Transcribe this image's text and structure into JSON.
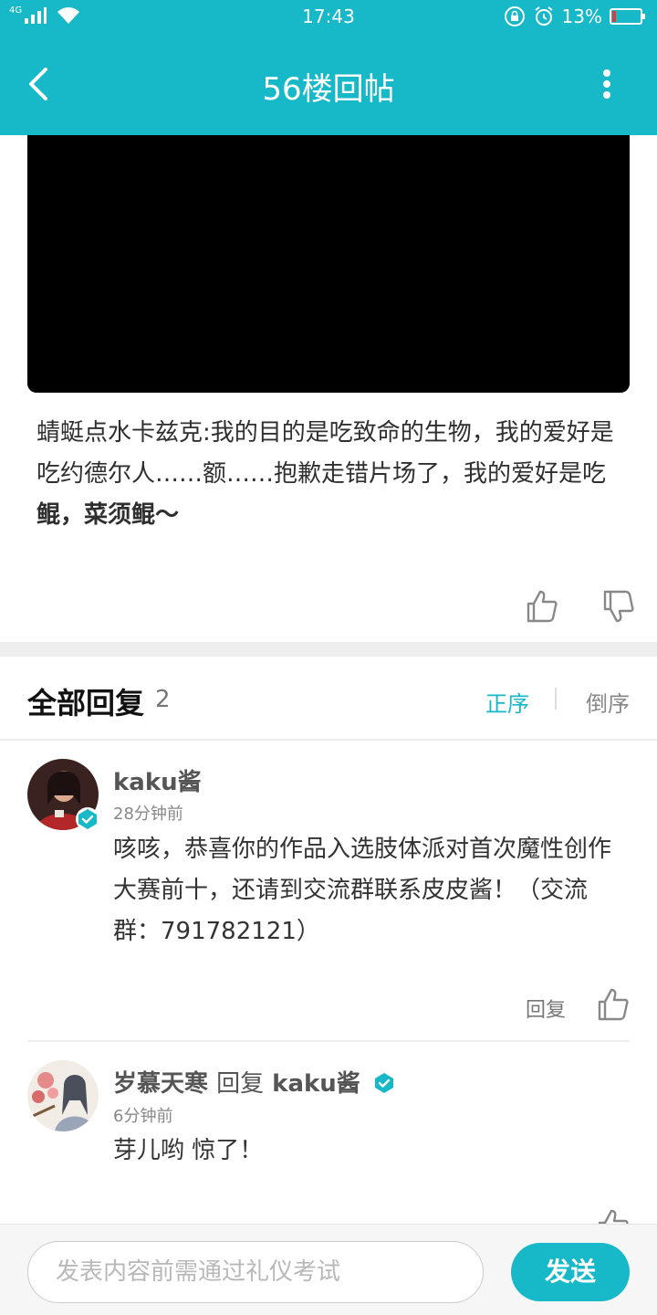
{
  "status_bar": {
    "network": "4G",
    "time": "17:43",
    "battery": "13%",
    "battery_level": 0.13
  },
  "header": {
    "title": "56楼回帖"
  },
  "post": {
    "text_plain": "蜻蜓点水卡兹克:我的目的是吃致命的生物，我的爱好是吃约德尔人……额……抱歉走错片场了，我的爱好是吃",
    "text_bold": "鲲，菜须鲲～"
  },
  "replies": {
    "title": "全部回复",
    "count": "2",
    "sort_asc": "正序",
    "sort_desc": "倒序",
    "items": [
      {
        "user": "kaku酱",
        "time": "28分钟前",
        "content": "咳咳，恭喜你的作品入选肢体派对首次魔性创作大赛前十，还请到交流群联系皮皮酱！（交流群：791782121）",
        "reply_label": "回复",
        "verified": true
      },
      {
        "user": "岁慕天寒",
        "reply_word": "回复",
        "reply_target": "kaku酱",
        "time": "6分钟前",
        "content": "芽儿哟 惊了！",
        "target_verified": true
      }
    ]
  },
  "composer": {
    "placeholder": "发表内容前需通过礼仪考试",
    "send_label": "发送"
  },
  "colors": {
    "accent": "#17b8c8",
    "battery_low": "#e53935"
  }
}
